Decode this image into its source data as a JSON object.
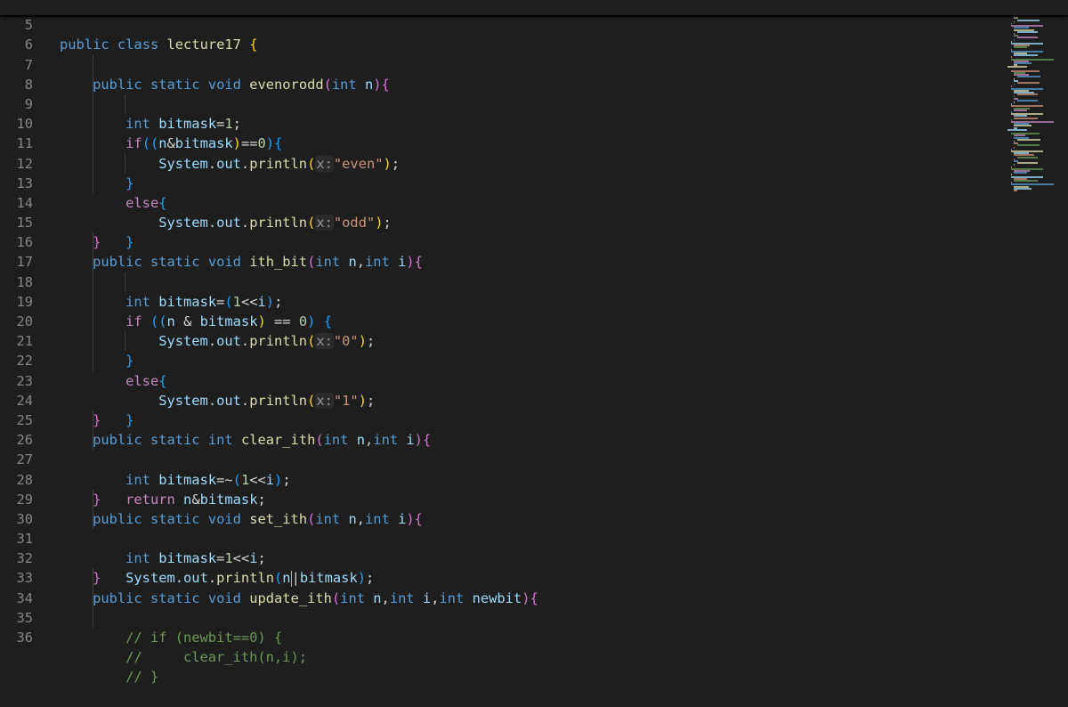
{
  "editor": {
    "colors": {
      "background": "#1e1e1e",
      "line_number": "#858585",
      "keyword": "#569cd6",
      "function": "#dcdcaa",
      "string": "#ce9178",
      "comment": "#6a9955"
    },
    "lines": [
      {
        "num": "5",
        "text": "public class lecture17 {"
      },
      {
        "num": "6",
        "text": ""
      },
      {
        "num": "7",
        "text": "    public static void evenorodd(int n){"
      },
      {
        "num": "8",
        "text": "        int bitmask=1;"
      },
      {
        "num": "9",
        "text": "        if((n&bitmask)==0){"
      },
      {
        "num": "10",
        "text": "            System.out.println(x:\"even\");"
      },
      {
        "num": "11",
        "text": "        }"
      },
      {
        "num": "12",
        "text": "        else{"
      },
      {
        "num": "13",
        "text": "            System.out.println(x:\"odd\");"
      },
      {
        "num": "14",
        "text": "        }"
      },
      {
        "num": "15",
        "text": "    }"
      },
      {
        "num": "16",
        "text": "    public static void ith_bit(int n,int i){"
      },
      {
        "num": "17",
        "text": "        int bitmask=(1<<i);"
      },
      {
        "num": "18",
        "text": "        if ((n & bitmask) == 0) {"
      },
      {
        "num": "19",
        "text": "            System.out.println(x:\"0\");"
      },
      {
        "num": "20",
        "text": "        }"
      },
      {
        "num": "21",
        "text": "        else{"
      },
      {
        "num": "22",
        "text": "            System.out.println(x:\"1\");"
      },
      {
        "num": "23",
        "text": "        }"
      },
      {
        "num": "24",
        "text": "    }"
      },
      {
        "num": "25",
        "text": "    public static int clear_ith(int n,int i){"
      },
      {
        "num": "26",
        "text": "        int bitmask=~(1<<i);"
      },
      {
        "num": "27",
        "text": "        return n&bitmask;"
      },
      {
        "num": "28",
        "text": "    }"
      },
      {
        "num": "29",
        "text": "    public static void set_ith(int n,int i){"
      },
      {
        "num": "30",
        "text": "        int bitmask=1<<i;"
      },
      {
        "num": "31",
        "text": "        System.out.println(n|bitmask);"
      },
      {
        "num": "32",
        "text": "    }"
      },
      {
        "num": "33",
        "text": "    public static void update_ith(int n,int i,int newbit){"
      },
      {
        "num": "34",
        "text": "        // if (newbit==0) {"
      },
      {
        "num": "35",
        "text": "        //     clear_ith(n,i);"
      },
      {
        "num": "36",
        "text": "        // }"
      }
    ]
  }
}
